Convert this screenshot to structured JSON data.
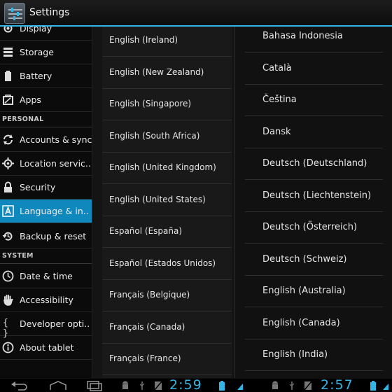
{
  "actionbar": {
    "title": "Settings",
    "icon": "settings-sliders-icon"
  },
  "sidebar": {
    "items": [
      {
        "id": "display",
        "label": "Display",
        "icon": "display-icon"
      },
      {
        "id": "storage",
        "label": "Storage",
        "icon": "storage-icon"
      },
      {
        "id": "battery",
        "label": "Battery",
        "icon": "battery-icon"
      },
      {
        "id": "apps",
        "label": "Apps",
        "icon": "apps-icon"
      }
    ],
    "personal_header": "PERSONAL",
    "personal": [
      {
        "id": "accounts",
        "label": "Accounts & sync",
        "icon": "sync-icon"
      },
      {
        "id": "location",
        "label": "Location servic..",
        "icon": "location-icon"
      },
      {
        "id": "security",
        "label": "Security",
        "icon": "lock-icon"
      },
      {
        "id": "language",
        "label": "Language & in..",
        "icon": "language-icon",
        "selected": true
      },
      {
        "id": "backup",
        "label": "Backup & reset",
        "icon": "backup-icon"
      }
    ],
    "system_header": "SYSTEM",
    "system": [
      {
        "id": "datetime",
        "label": "Date & time",
        "icon": "clock-icon"
      },
      {
        "id": "accessibility",
        "label": "Accessibility",
        "icon": "hand-icon"
      },
      {
        "id": "developer",
        "label": "Developer opti..",
        "icon": "braces-icon"
      },
      {
        "id": "about",
        "label": "About tablet",
        "icon": "info-icon"
      }
    ]
  },
  "middle_list": [
    "English (Ireland)",
    "English (New Zealand)",
    "English (Singapore)",
    "English (South Africa)",
    "English (United Kingdom)",
    "English (United States)",
    "Español (España)",
    "Español (Estados Unidos)",
    "Français (Belgique)",
    "Français (Canada)",
    "Français (France)"
  ],
  "right_list": [
    "Bahasa Indonesia",
    "Català",
    "Čeština",
    "Dansk",
    "Deutsch (Deutschland)",
    "Deutsch (Liechtenstein)",
    "Deutsch (Österreich)",
    "Deutsch (Schweiz)",
    "English (Australia)",
    "English (Canada)",
    "English (India)"
  ],
  "statusbar": {
    "clock_left": "2:59",
    "clock_right": "2:57",
    "accent": "#33b5e5"
  },
  "colors": {
    "accent": "#33b5e5",
    "selected": "#0e88bd"
  }
}
